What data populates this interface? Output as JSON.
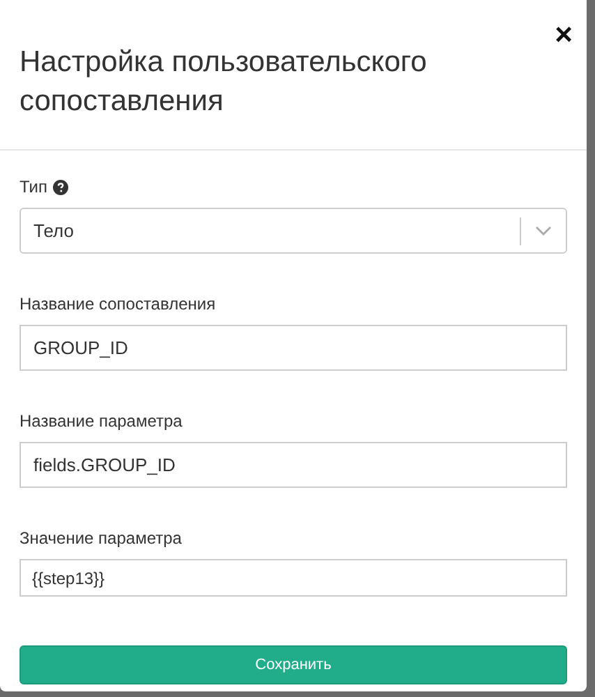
{
  "dialog": {
    "title": "Настройка пользовательского сопоставления",
    "close": "×"
  },
  "type_field": {
    "label": "Тип",
    "value": "Тело"
  },
  "fields": [
    {
      "label": "Название сопоставления",
      "value": "GROUP_ID"
    },
    {
      "label": "Название параметра",
      "value": "fields.GROUP_ID"
    },
    {
      "label": "Значение параметра",
      "value": "{{step13}}"
    }
  ],
  "save_button": "Сохранить"
}
